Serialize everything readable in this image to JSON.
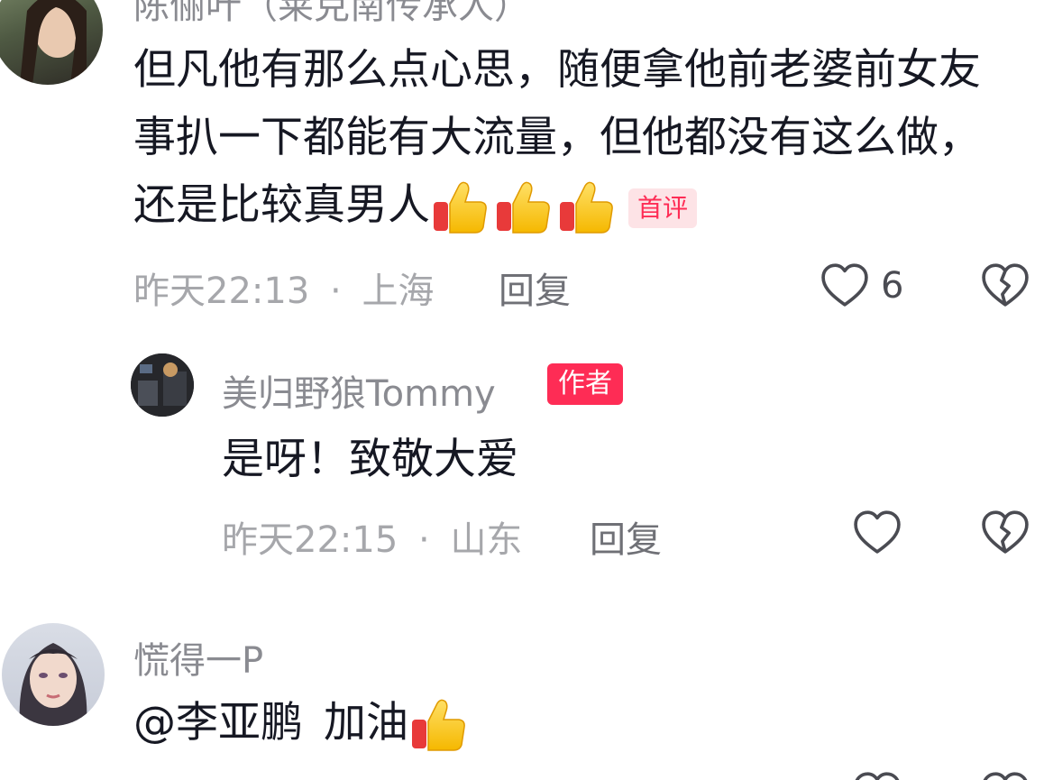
{
  "comments": [
    {
      "username": "陈俪叶（莱克南传承人）",
      "text": "但凡他有那么点心思，随便拿他前老婆前女友事扒一下都能有大流量，但他都没有这么做，还是比较真男人",
      "badge": "首评",
      "time": "昨天22:13",
      "location": "上海",
      "reply_label": "回复",
      "like_count": "6"
    },
    {
      "username": "美归野狼Tommy",
      "author_badge": "作者",
      "text": "是呀！致敬大爱",
      "time": "昨天22:15",
      "location": "山东",
      "reply_label": "回复"
    },
    {
      "username": "慌得一P",
      "mention": "@李亚鹏",
      "text": "加油"
    }
  ],
  "separator": "·",
  "icons": {
    "like": "heart-outline-icon",
    "dislike": "broken-heart-icon",
    "emoji": "thumbs-up-emoji"
  },
  "colors": {
    "primary_text": "#161823",
    "secondary_text": "#8a8b91",
    "accent": "#fe2c55"
  }
}
